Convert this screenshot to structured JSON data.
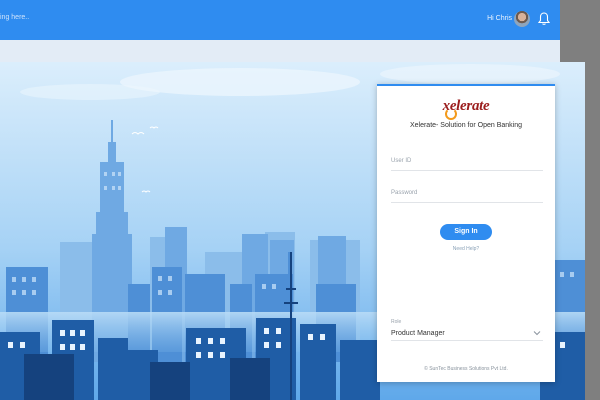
{
  "back": {
    "search_hint": "ing here..",
    "greeting": "Hi Chris",
    "icons": [
      "avatar",
      "bell-icon"
    ]
  },
  "login": {
    "logo_text": "xelerate",
    "subtitle": "Xelerate- Solution for Open Banking",
    "user_id_label": "User ID",
    "password_label": "Password",
    "signin_label": "Sign In",
    "need_help": "Need Help?",
    "role_label": "Role",
    "role_value": "Product Manager",
    "copyright": "© SunTec Business Solutions Pvt Ltd."
  },
  "colors": {
    "brand_blue": "#2f8cf0",
    "logo_red": "#9b1d1d",
    "logo_orange": "#f39a1c"
  }
}
